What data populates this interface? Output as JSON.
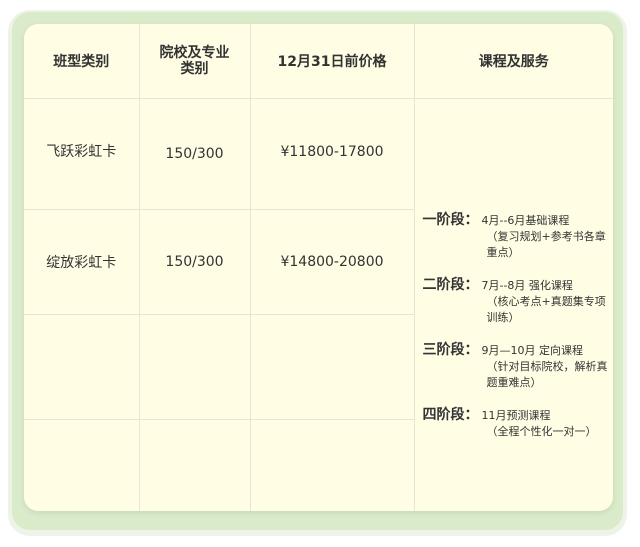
{
  "table": {
    "headers": {
      "class_type": "班型类别",
      "school_major_line1": "院校及专业",
      "school_major_line2": "类别",
      "price": "12月31日前价格",
      "services": "课程及服务"
    },
    "rows": [
      {
        "class_type": "飞跃彩虹卡",
        "school_major": "150/300",
        "price": "¥11800-17800"
      },
      {
        "class_type": "绽放彩虹卡",
        "school_major": "150/300",
        "price": "¥14800-20800"
      },
      {
        "class_type": "",
        "school_major": "",
        "price": ""
      },
      {
        "class_type": "",
        "school_major": "",
        "price": ""
      }
    ],
    "stages": [
      {
        "label": "一阶段：",
        "line1": "4月--6月基础课程",
        "line2": "（复习规划+参考书各章重点）"
      },
      {
        "label": "二阶段：",
        "line1": "7月--8月 强化课程",
        "line2": "（核心考点+真题集专项训练）"
      },
      {
        "label": "三阶段：",
        "line1": "9月—10月 定向课程",
        "line2": "（针对目标院校，解析真题重难点）"
      },
      {
        "label": "四阶段：",
        "line1": "11月预测课程",
        "line2": "（全程个性化一对一）"
      }
    ]
  }
}
